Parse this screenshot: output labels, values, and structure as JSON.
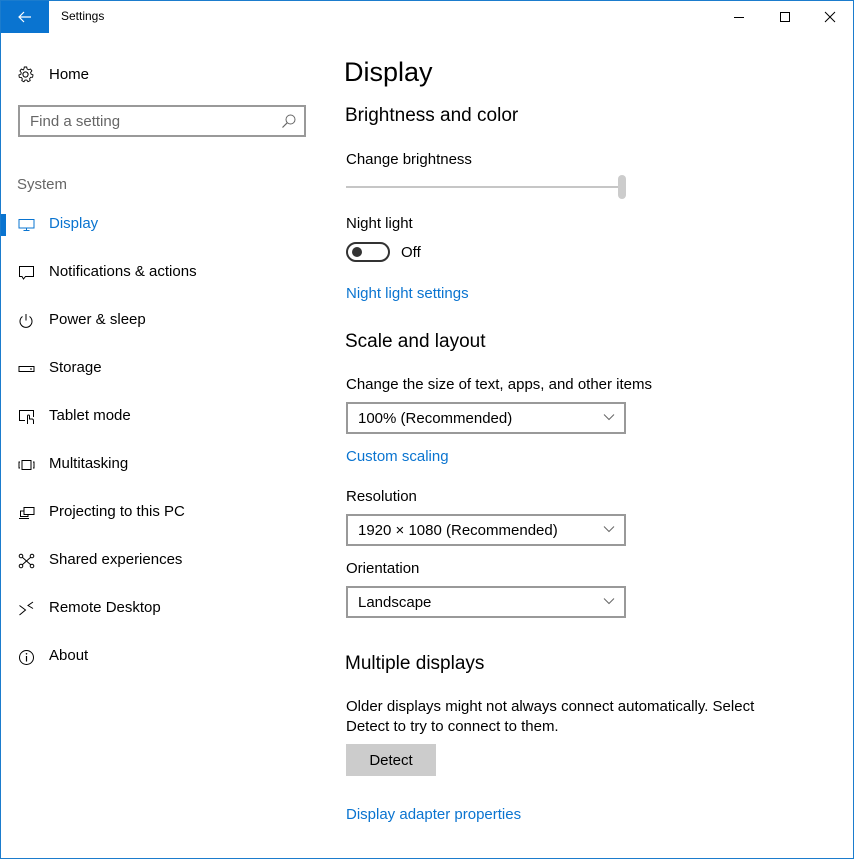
{
  "window": {
    "title": "Settings",
    "accent_color": "#0a74d0",
    "controls": {
      "minimize": "minimize",
      "maximize": "maximize",
      "close": "close"
    }
  },
  "sidebar": {
    "home_label": "Home",
    "search_placeholder": "Find a setting",
    "section_label": "System",
    "items": [
      {
        "label": "Display",
        "icon": "monitor-icon",
        "active": true
      },
      {
        "label": "Notifications & actions",
        "icon": "notification-icon",
        "active": false
      },
      {
        "label": "Power & sleep",
        "icon": "power-icon",
        "active": false
      },
      {
        "label": "Storage",
        "icon": "storage-icon",
        "active": false
      },
      {
        "label": "Tablet mode",
        "icon": "tablet-mode-icon",
        "active": false
      },
      {
        "label": "Multitasking",
        "icon": "multitasking-icon",
        "active": false
      },
      {
        "label": "Projecting to this PC",
        "icon": "projecting-icon",
        "active": false
      },
      {
        "label": "Shared experiences",
        "icon": "shared-experiences-icon",
        "active": false
      },
      {
        "label": "Remote Desktop",
        "icon": "remote-desktop-icon",
        "active": false
      },
      {
        "label": "About",
        "icon": "info-icon",
        "active": false
      }
    ]
  },
  "main": {
    "page_title": "Display",
    "brightness_section": {
      "heading": "Brightness and color",
      "brightness_label": "Change brightness",
      "brightness_value_percent": 100,
      "night_light_label": "Night light",
      "night_light_state": "Off",
      "night_light_on": false,
      "night_light_settings_link": "Night light settings"
    },
    "scale_section": {
      "heading": "Scale and layout",
      "scale_label": "Change the size of text, apps, and other items",
      "scale_value": "100% (Recommended)",
      "custom_scaling_link": "Custom scaling",
      "resolution_label": "Resolution",
      "resolution_value": "1920 × 1080 (Recommended)",
      "orientation_label": "Orientation",
      "orientation_value": "Landscape"
    },
    "multiple_displays": {
      "heading": "Multiple displays",
      "description": "Older displays might not always connect automatically. Select Detect to try to connect to them.",
      "detect_button": "Detect",
      "adapter_link": "Display adapter properties"
    }
  }
}
